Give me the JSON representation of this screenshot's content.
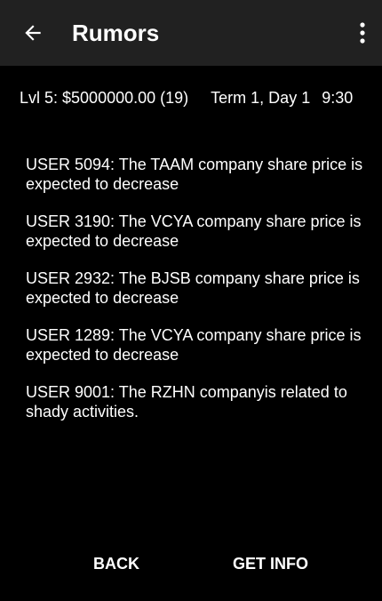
{
  "toolbar": {
    "title": "Rumors",
    "back_icon": "arrow-left-icon",
    "menu_icon": "more-vert-icon",
    "background": "#212121"
  },
  "status": {
    "level": "Lvl 5: $5000000.00 (19)",
    "term": "Term 1, Day 1",
    "time": "9:30"
  },
  "rumors": [
    "USER 5094: The TAAM company share price is expected to decrease",
    "USER 3190: The VCYA company share price is expected to decrease",
    "USER 2932: The BJSB company share price is expected to decrease",
    "USER 1289: The VCYA company share price is expected to decrease",
    "USER 9001: The RZHN companyis related to shady activities."
  ],
  "buttons": {
    "back_label": "BACK",
    "info_label": "GET INFO"
  }
}
